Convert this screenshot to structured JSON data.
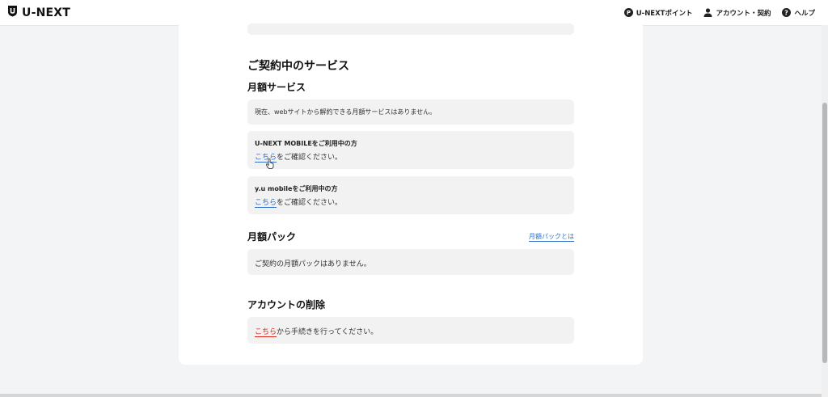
{
  "header": {
    "logo_text": "U-NEXT",
    "nav": [
      {
        "label": "U-NEXTポイント",
        "icon": "point-icon"
      },
      {
        "label": "アカウント・契約",
        "icon": "user-icon"
      },
      {
        "label": "ヘルプ",
        "icon": "help-icon"
      }
    ]
  },
  "main": {
    "section_title": "ご契約中のサービス",
    "monthly_services": {
      "title": "月額サービス",
      "notice": "現在、webサイトから解約できる月額サービスはありません。",
      "mobile": {
        "title": "U-NEXT MOBILEをご利用中の方",
        "link": "こちら",
        "rest": "をご確認ください。"
      },
      "yu_mobile": {
        "title": "y.u mobileをご利用中の方",
        "link": "こちら",
        "rest": "をご確認ください。"
      }
    },
    "monthly_pack": {
      "title": "月額パック",
      "info_link": "月額パックとは",
      "notice": "ご契約の月額パックはありません。"
    },
    "account_delete": {
      "title": "アカウントの削除",
      "link": "こちら",
      "rest": "から手続きを行ってください。"
    }
  },
  "colors": {
    "link": "#2f6fc7",
    "danger": "#e0231b",
    "box": "#f2f2f2",
    "page_bg": "#f3f4f6"
  }
}
